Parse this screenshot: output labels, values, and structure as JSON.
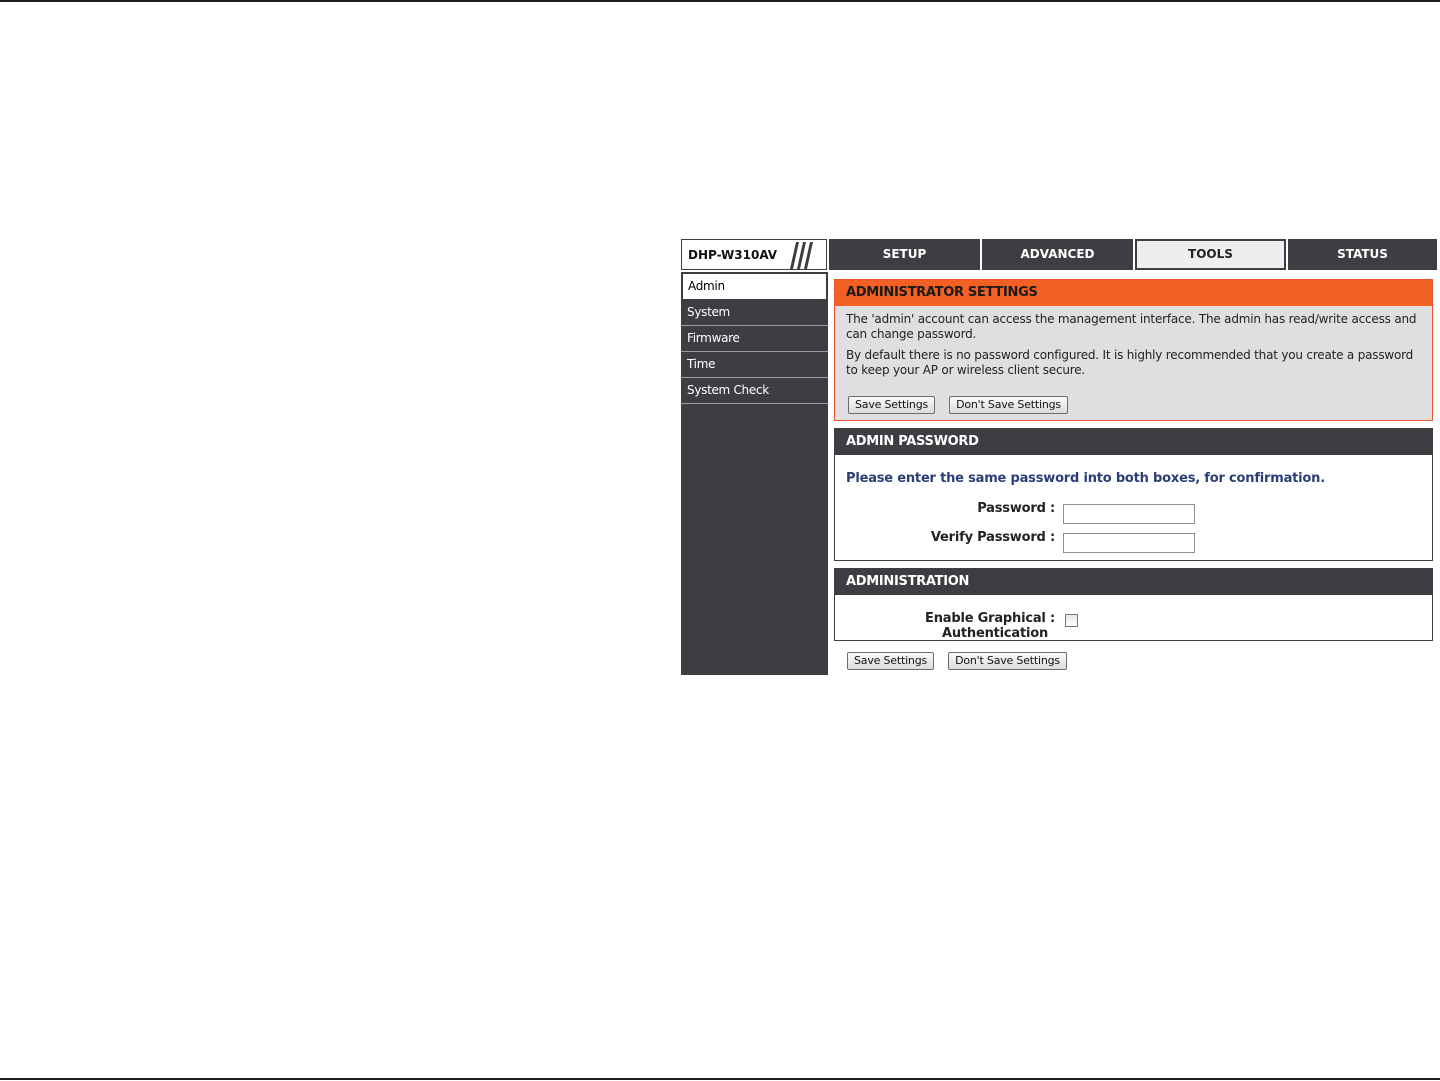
{
  "model": {
    "name": "DHP-W310AV"
  },
  "tabs": [
    {
      "label": "SETUP",
      "active": false
    },
    {
      "label": "ADVANCED",
      "active": false
    },
    {
      "label": "TOOLS",
      "active": true
    },
    {
      "label": "STATUS",
      "active": false
    }
  ],
  "sidebar": {
    "items": [
      {
        "label": "Admin",
        "active": true
      },
      {
        "label": "System"
      },
      {
        "label": "Firmware"
      },
      {
        "label": "Time"
      },
      {
        "label": "System Check"
      }
    ]
  },
  "admin_settings": {
    "title": "ADMINISTRATOR SETTINGS",
    "paragraph1": "The 'admin' account can access the management interface. The admin has read/write access and can change password.",
    "paragraph2": "By default there is no password configured. It is highly recommended that you create a password to keep your AP or wireless client secure.",
    "save_label": "Save Settings",
    "dont_save_label": "Don't Save Settings"
  },
  "admin_password": {
    "title": "ADMIN PASSWORD",
    "intro": "Please enter the same password into both boxes, for confirmation.",
    "password_label": "Password :",
    "password_value": "",
    "verify_label": "Verify Password :",
    "verify_value": ""
  },
  "administration": {
    "title": "ADMINISTRATION",
    "graphical_auth_label_line1": "Enable Graphical :",
    "graphical_auth_label_line2": "Authentication",
    "graphical_auth_checked": false
  },
  "footer_buttons": {
    "save_label": "Save Settings",
    "dont_save_label": "Don't Save Settings"
  },
  "colors": {
    "nav_dark": "#3c3e42",
    "accent_orange": "#f26023",
    "intro_text": "#2c3e78"
  }
}
